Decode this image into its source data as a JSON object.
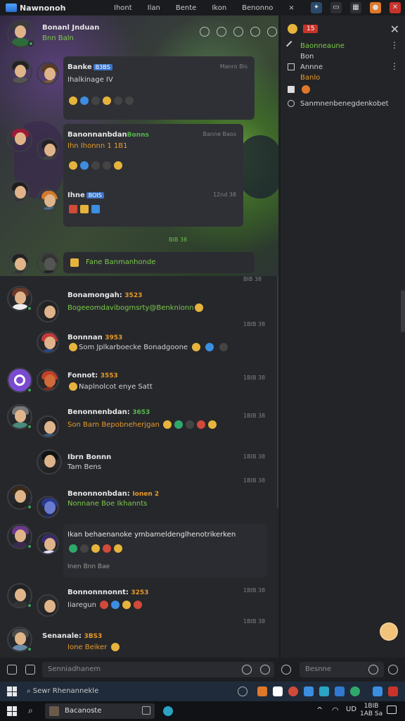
{
  "titlebar": {
    "app_title": "Nawnonoh",
    "menu": [
      "Ihont",
      "Ilan",
      "Bente",
      "Ikon",
      "Benonno"
    ],
    "close_glyph": "×"
  },
  "chat": {
    "header": {
      "name": "Bonanl Jnduan",
      "status": "Bnn Baln"
    },
    "messages": [
      {
        "name": "Banke",
        "tag": "B3BS",
        "time": "Manro Bis",
        "text": "Ihalkinage IV"
      },
      {
        "name": "Banonnanbdan",
        "tag": "Bonns",
        "time": "Banne Baos",
        "text": "Ihn Ihonnn 1 1B1"
      },
      {
        "name": "Ihne",
        "tag": "BOIS",
        "time": "12nd 38"
      },
      {
        "time": "BIB 38",
        "text": "Fane Banmanhonde"
      },
      {
        "name": "Bonamongah:",
        "level": "3523",
        "time": "1BIB 38",
        "text": "Bogeeomdavibogmsrty@Benknionn"
      },
      {
        "name": "Bonnnan",
        "level": "3953",
        "time": "1BIB 38",
        "text": "Som Jplkarboecke Bonadgoone"
      },
      {
        "name": "Fonnot:",
        "level": "3553",
        "time": "1BIB 38",
        "text": "Naplnolcot enye Satt"
      },
      {
        "name": "Benonnenbdan:",
        "level": "3653",
        "time": "1BIB 38",
        "text": "Son Barn Bepobneherjgan"
      },
      {
        "name": "Ibrn Bonnn",
        "time": "1BIB 38",
        "text": "Tam Bens"
      },
      {
        "name": "Benonnonbdan:",
        "level": "Ionen 2",
        "time": "1BIB 38",
        "text": "Nonnane Boe Ikhannts"
      },
      {
        "text": "Ikan behaenanoke ymbameldenglhenotrikerken",
        "time": "1BIB 38",
        "sub": "Inen Bnn Bae"
      },
      {
        "name": "Bonnonnnonnt:",
        "level": "3253",
        "time": "1BIB 38",
        "text": "Iiaregun"
      },
      {
        "name": "Senanale:",
        "level": "3BS3",
        "time": "",
        "text": "Ione Beiker"
      }
    ]
  },
  "panel": {
    "badge": "15",
    "items": [
      {
        "title": "Baonneaune",
        "sub": "Bon"
      },
      {
        "title": "Annne",
        "sub": "Banlo"
      },
      {
        "title": "",
        "sub": ""
      },
      {
        "title": "Sanmnenbenegdenkobet",
        "sub": ""
      }
    ]
  },
  "inputbar": {
    "left_placeholder": "Senniadhanem",
    "right_placeholder": "Besnne"
  },
  "taskbar": {
    "search_placeholder": "Sewr Rhenannekle",
    "open_window": "Bacanoste",
    "lang": "UD",
    "clock_time": "1BIB",
    "clock_date": "1AB Sa"
  },
  "colors": {
    "accent_green": "#7ccb4a",
    "accent_orange": "#e59a2a",
    "online": "#3ba55d",
    "tag_blue": "#3a74c9"
  }
}
